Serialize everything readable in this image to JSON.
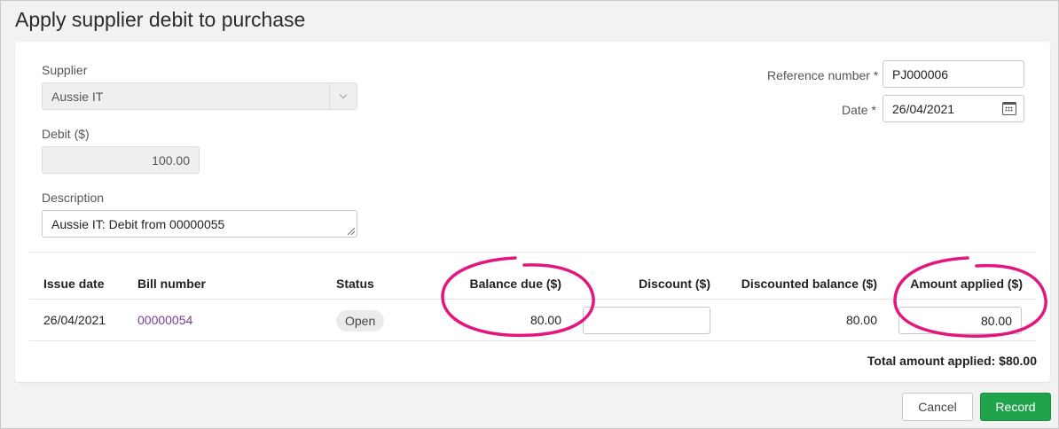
{
  "page": {
    "title": "Apply supplier debit to purchase"
  },
  "form": {
    "supplier": {
      "label": "Supplier",
      "value": "Aussie IT"
    },
    "debit": {
      "label": "Debit ($)",
      "value": "100.00"
    },
    "description": {
      "label": "Description",
      "value": "Aussie IT: Debit from 00000055"
    },
    "reference_number": {
      "label": "Reference number",
      "required_mark": "*",
      "value": "PJ000006"
    },
    "date": {
      "label": "Date",
      "required_mark": "*",
      "value": "26/04/2021"
    }
  },
  "table": {
    "headers": {
      "issue_date": "Issue date",
      "bill_number": "Bill number",
      "status": "Status",
      "balance_due": "Balance due ($)",
      "discount": "Discount ($)",
      "discounted_balance": "Discounted balance ($)",
      "amount_applied": "Amount applied ($)"
    },
    "rows": [
      {
        "issue_date": "26/04/2021",
        "bill_number": "00000054",
        "status": "Open",
        "balance_due": "80.00",
        "discount": "",
        "discounted_balance": "80.00",
        "amount_applied": "80.00"
      }
    ],
    "total": "Total amount applied: $80.00"
  },
  "actions": {
    "cancel_label": "Cancel",
    "record_label": "Record"
  },
  "colors": {
    "highlight": "#e3167f",
    "record_button": "#1fa34b",
    "link": "#7a3b8f"
  }
}
